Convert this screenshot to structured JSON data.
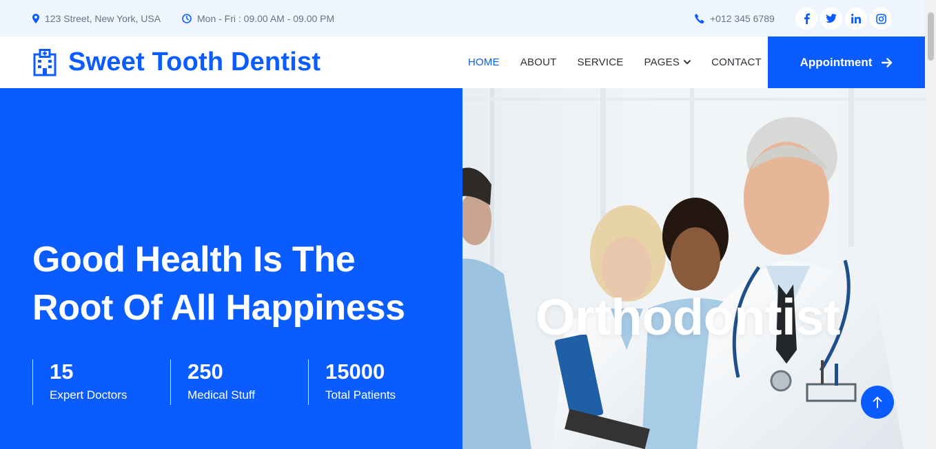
{
  "topbar": {
    "address": "123 Street, New York, USA",
    "hours": "Mon - Fri : 09.00 AM - 09.00 PM",
    "phone": "+012 345 6789",
    "socials": [
      {
        "icon": "facebook-icon",
        "glyph": "f"
      },
      {
        "icon": "twitter-icon",
        "glyph": "t"
      },
      {
        "icon": "linkedin-icon",
        "glyph": "in"
      },
      {
        "icon": "instagram-icon",
        "glyph": "ig"
      }
    ]
  },
  "navbar": {
    "brand": "Sweet Tooth Dentist",
    "brand_icon": "hospital-icon",
    "items": [
      {
        "label": "HOME",
        "active": true
      },
      {
        "label": "ABOUT"
      },
      {
        "label": "SERVICE"
      },
      {
        "label": "PAGES",
        "dropdown": true
      },
      {
        "label": "CONTACT"
      }
    ],
    "cta": "Appointment"
  },
  "hero": {
    "title_line1": "Good Health Is The",
    "title_line2": "Root Of All Happiness",
    "stats": [
      {
        "value": "15",
        "label": "Expert Doctors"
      },
      {
        "value": "250",
        "label": "Medical Stuff"
      },
      {
        "value": "15000",
        "label": "Total Patients"
      }
    ],
    "image_caption": "Orthodontist"
  },
  "colors": {
    "primary": "#0a5cff",
    "topbar_bg": "#eef5ff",
    "text_dark": "#2b2f36",
    "text_muted": "#6b7280"
  }
}
